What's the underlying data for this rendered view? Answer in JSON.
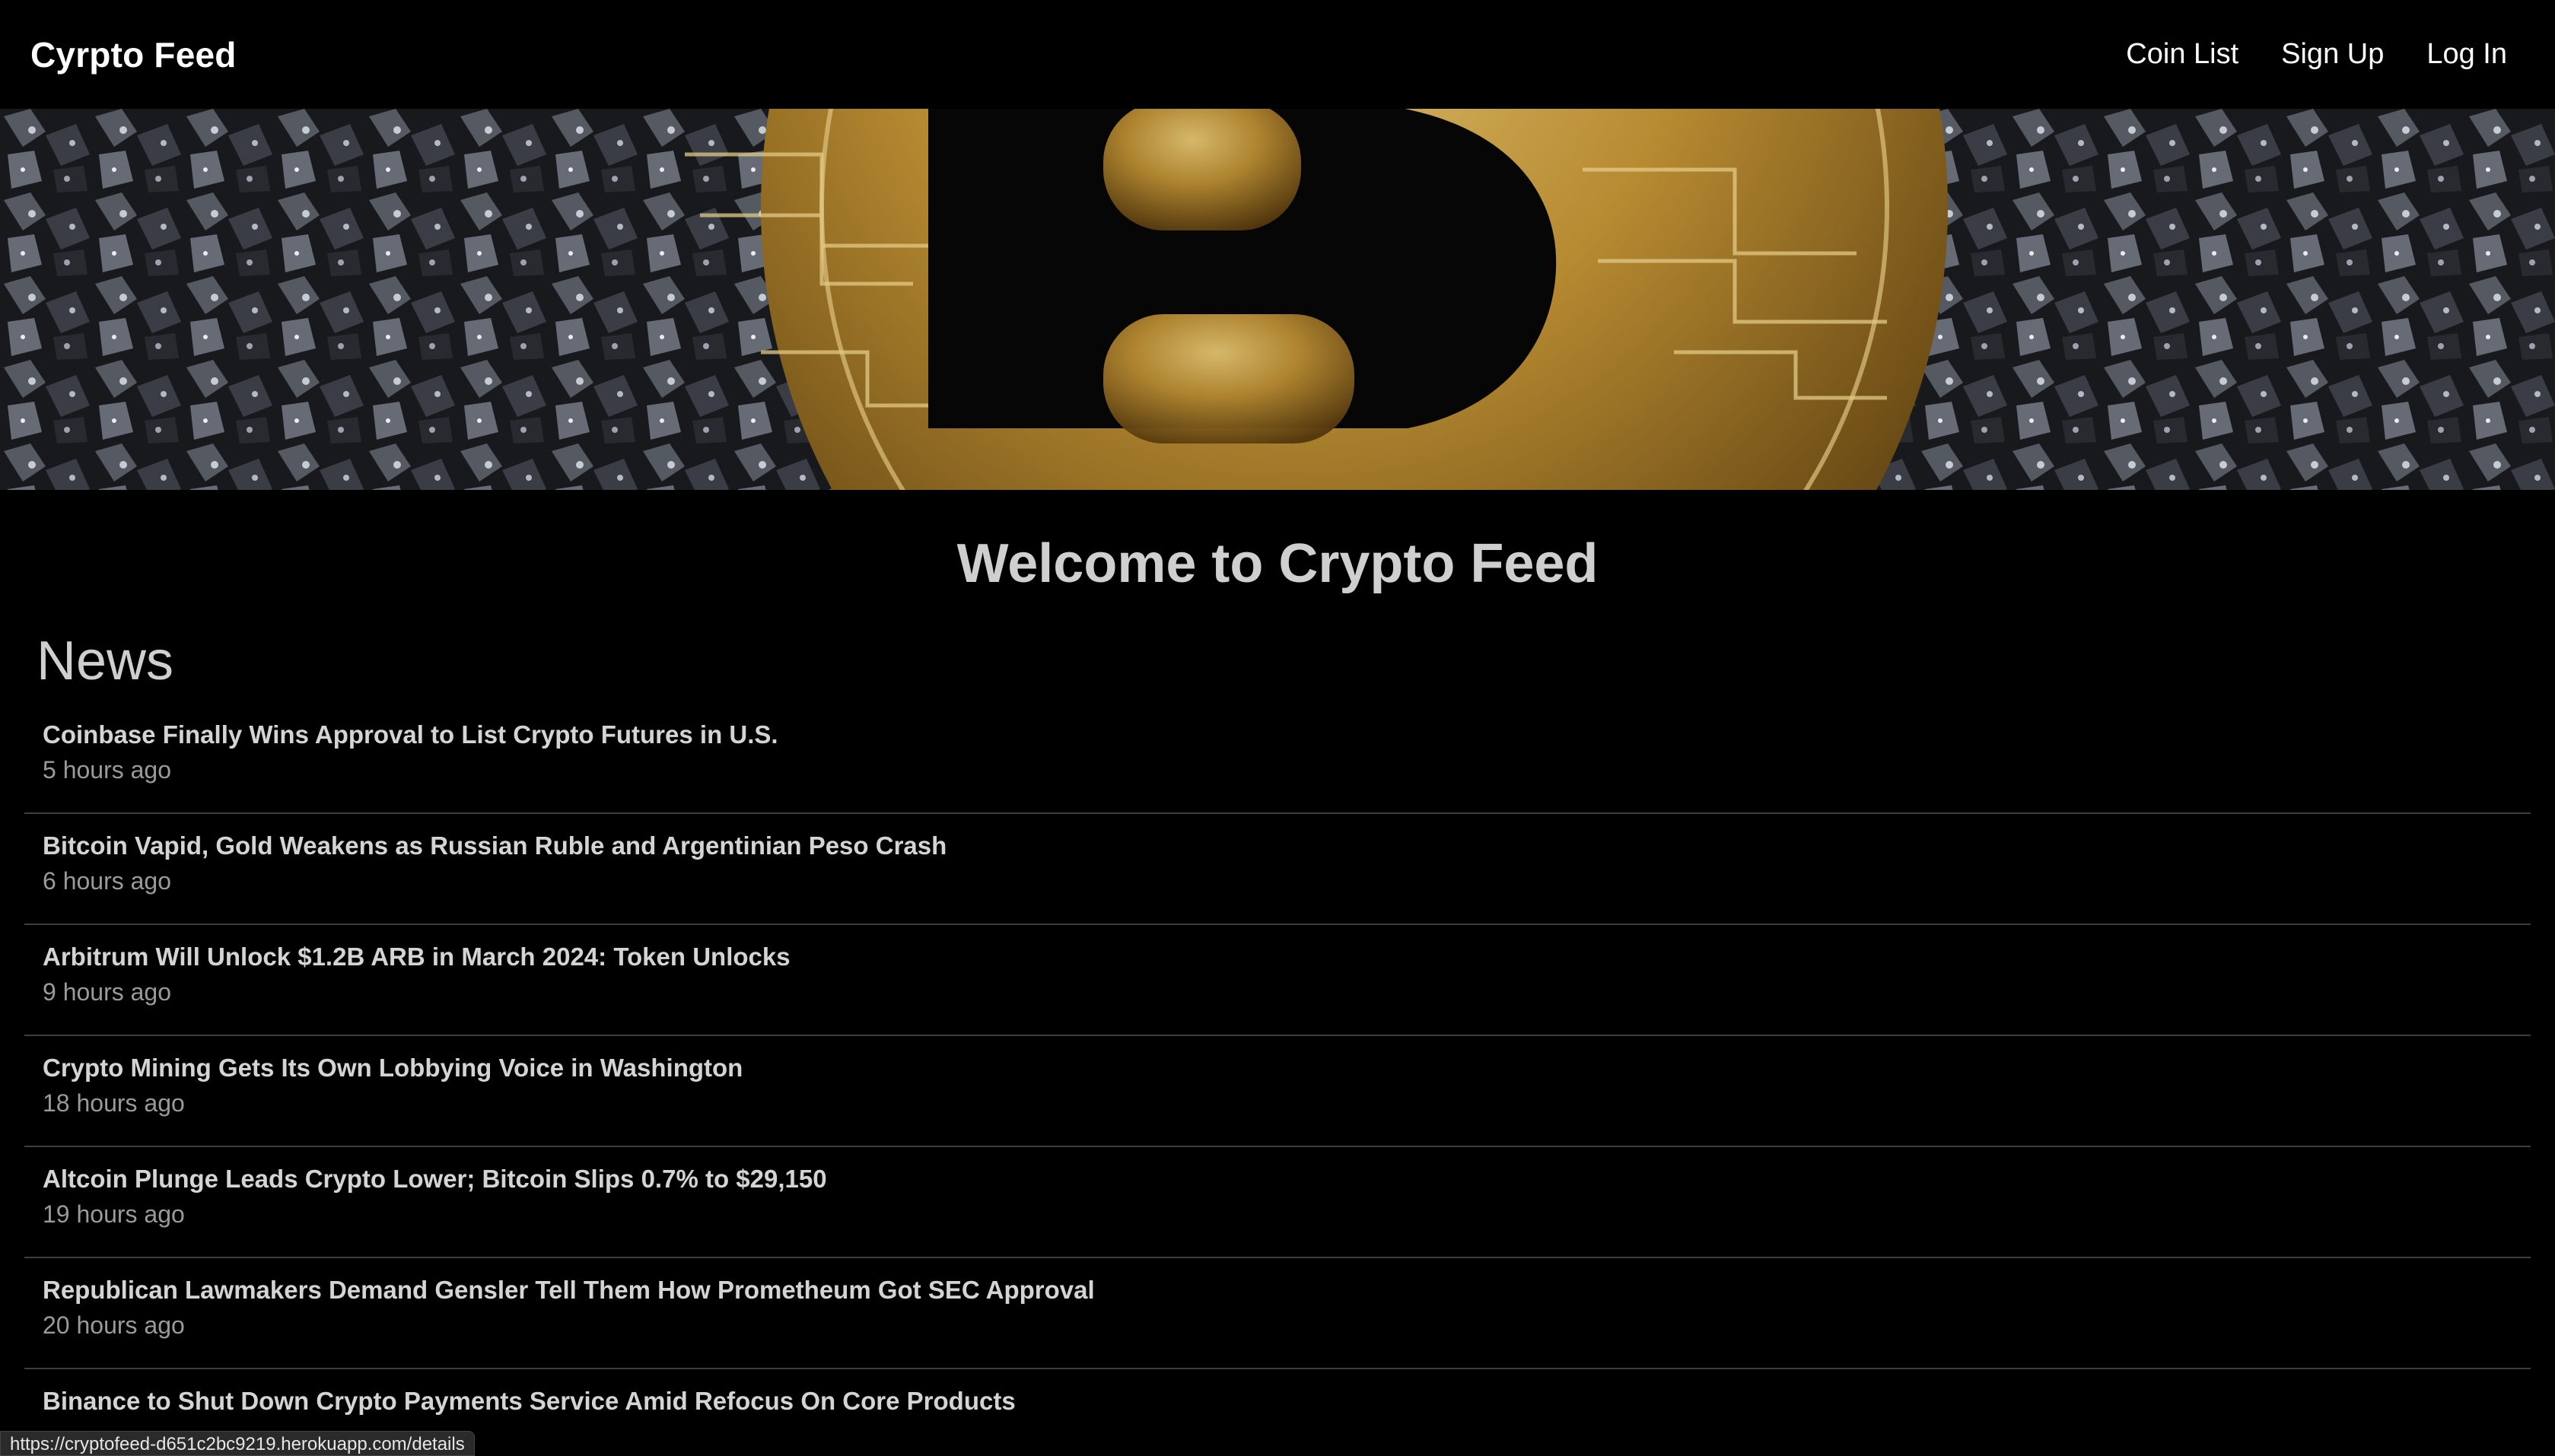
{
  "navbar": {
    "brand": "Cyrpto Feed",
    "links": [
      "Coin List",
      "Sign Up",
      "Log In"
    ]
  },
  "hero": {
    "image": "bitcoin-coin-banner"
  },
  "welcome_heading": "Welcome to Crypto Feed",
  "news": {
    "heading": "News",
    "items": [
      {
        "headline": "Coinbase Finally Wins Approval to List Crypto Futures in U.S.",
        "time": "5 hours ago"
      },
      {
        "headline": "Bitcoin Vapid, Gold Weakens as Russian Ruble and Argentinian Peso Crash",
        "time": "6 hours ago"
      },
      {
        "headline": "Arbitrum Will Unlock $1.2B ARB in March 2024: Token Unlocks",
        "time": "9 hours ago"
      },
      {
        "headline": "Crypto Mining Gets Its Own Lobbying Voice in Washington",
        "time": "18 hours ago"
      },
      {
        "headline": "Altcoin Plunge Leads Crypto Lower; Bitcoin Slips 0.7% to $29,150",
        "time": "19 hours ago"
      },
      {
        "headline": "Republican Lawmakers Demand Gensler Tell Them How Prometheum Got SEC Approval",
        "time": "20 hours ago"
      },
      {
        "headline": "Binance to Shut Down Crypto Payments Service Amid Refocus On Core Products",
        "time": ""
      }
    ]
  },
  "status_bar": {
    "url": "https://cryptofeed-d651c2bc9219.herokuapp.com/details"
  }
}
